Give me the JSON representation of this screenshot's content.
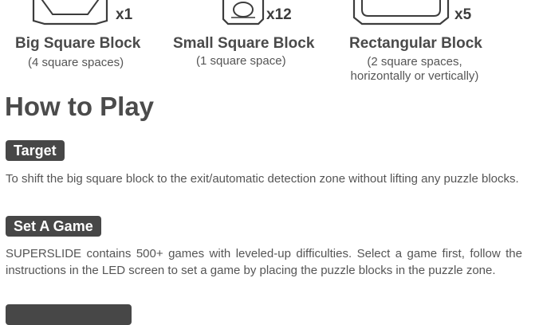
{
  "blocks": [
    {
      "qty": "x1",
      "name": "Big Square Block",
      "desc": [
        "(4 square spaces)"
      ]
    },
    {
      "qty": "x12",
      "name": "Small Square Block",
      "desc": [
        "(1 square space)"
      ]
    },
    {
      "qty": "x5",
      "name": "Rectangular Block",
      "desc": [
        "(2 square spaces,",
        "horizontally or vertically)"
      ]
    }
  ],
  "how_to_play": {
    "title": "How to Play",
    "target": {
      "label": "Target",
      "text": "To shift the big square block to the exit/automatic detection zone without lifting any puzzle blocks."
    },
    "set_game": {
      "label": "Set A Game",
      "text": "SUPERSLIDE contains 500+ games with leveled-up difficulties. Select a game first, follow the instructions in the LED screen to set a game by placing the puzzle blocks in the puzzle zone."
    }
  }
}
